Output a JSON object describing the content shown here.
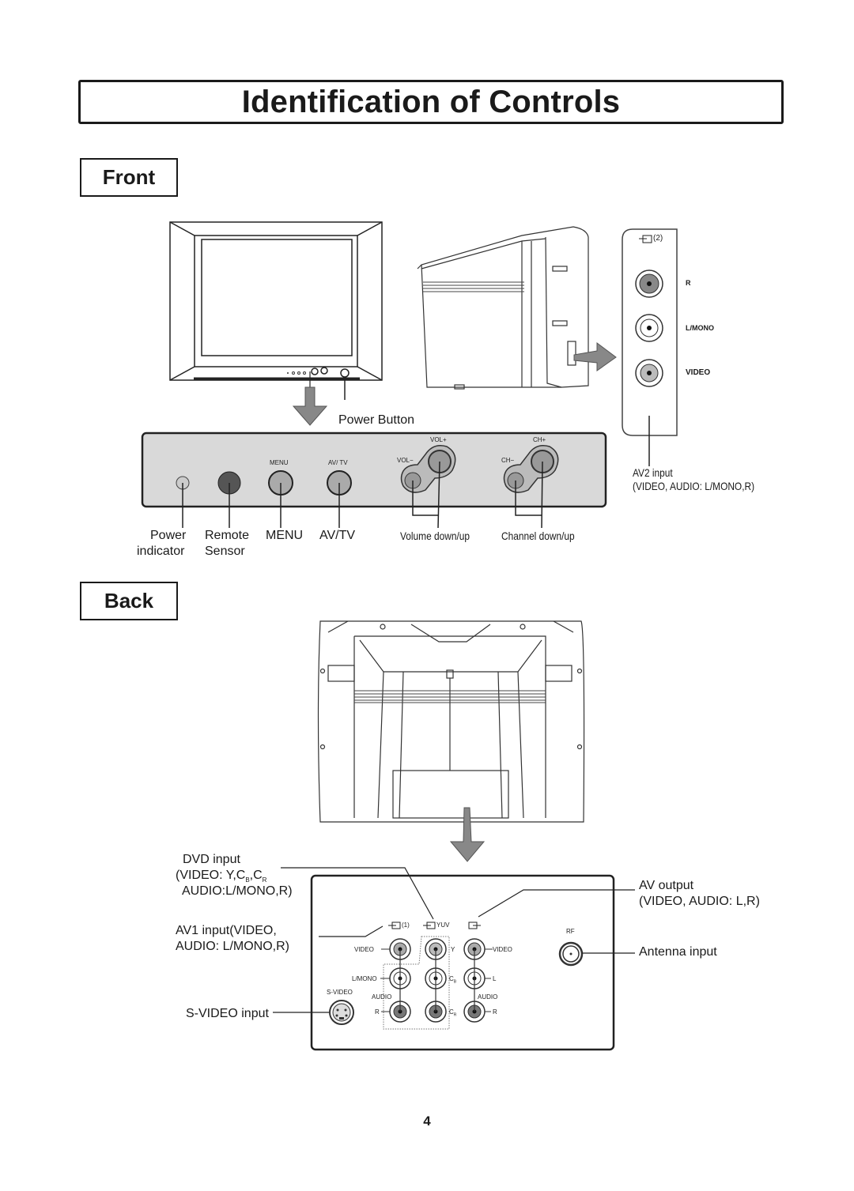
{
  "page": {
    "title": "Identification of Controls",
    "page_number": "4"
  },
  "front": {
    "section_label": "Front",
    "power_button_label": "Power Button",
    "side_panel": {
      "input_tag": "(2)",
      "jacks": [
        {
          "label": "R"
        },
        {
          "label": "L/MONO"
        },
        {
          "label": "VIDEO"
        }
      ],
      "caption_line1": "AV2 input",
      "caption_line2": "(VIDEO, AUDIO: L/MONO,R)"
    },
    "control_panel": {
      "button_tags": {
        "menu": "MENU",
        "avtv": "AV/ TV",
        "vol_minus": "VOL−",
        "vol_plus": "VOL+",
        "ch_minus": "CH−",
        "ch_plus": "CH+"
      },
      "callouts": {
        "power_indicator_1": "Power",
        "power_indicator_2": "indicator",
        "remote_sensor_1": "Remote",
        "remote_sensor_2": "Sensor",
        "menu": "MENU",
        "avtv": "AV/TV",
        "volume": "Volume down/up",
        "channel": "Channel down/up"
      }
    }
  },
  "back": {
    "section_label": "Back",
    "callouts": {
      "dvd_1": "DVD input",
      "dvd_2_prefix": "(VIDEO: Y,C",
      "dvd_2_sub_b": "B",
      "dvd_2_mid": ",C",
      "dvd_2_sub_r": "R",
      "dvd_3": "AUDIO:L/MONO,R)",
      "av1_1": "AV1 input(VIDEO,",
      "av1_2": "AUDIO: L/MONO,R)",
      "svideo": "S-VIDEO input",
      "avout_1": "AV output",
      "avout_2": "(VIDEO, AUDIO: L,R)",
      "antenna": "Antenna input"
    },
    "panel": {
      "group_tags": {
        "av1": "(1)",
        "yuv": "YUV"
      },
      "av1_labels": {
        "video": "VIDEO",
        "lmono": "L/MONO",
        "audio": "AUDIO",
        "r": "R"
      },
      "svideo_label": "S-VIDEO",
      "yuv_labels": {
        "y": "Y",
        "cb": "C",
        "cb_sub": "B",
        "cr": "C",
        "cr_sub": "R"
      },
      "out_labels": {
        "video": "VIDEO",
        "l": "L",
        "audio": "AUDIO",
        "r": "R"
      },
      "rf_label": "RF"
    }
  }
}
